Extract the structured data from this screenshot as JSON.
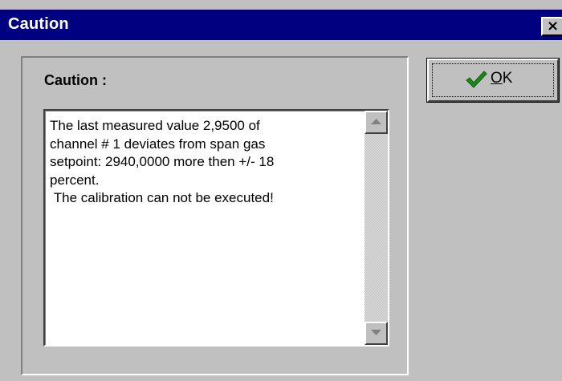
{
  "window": {
    "title": "Caution",
    "close_label": "×"
  },
  "panel": {
    "label": "Caution :"
  },
  "message": {
    "text": "The last measured value 2,9500 of\nchannel # 1 deviates from span gas\nsetpoint: 2940,0000 more then +/- 18\npercent.\n The calibration can not be executed!"
  },
  "ok_button": {
    "mnemonic": "O",
    "rest": "K",
    "icon": "checkmark-icon",
    "icon_color": "#1a8a1a"
  },
  "colors": {
    "titlebar": "#000080",
    "face": "#c0c0c0"
  }
}
